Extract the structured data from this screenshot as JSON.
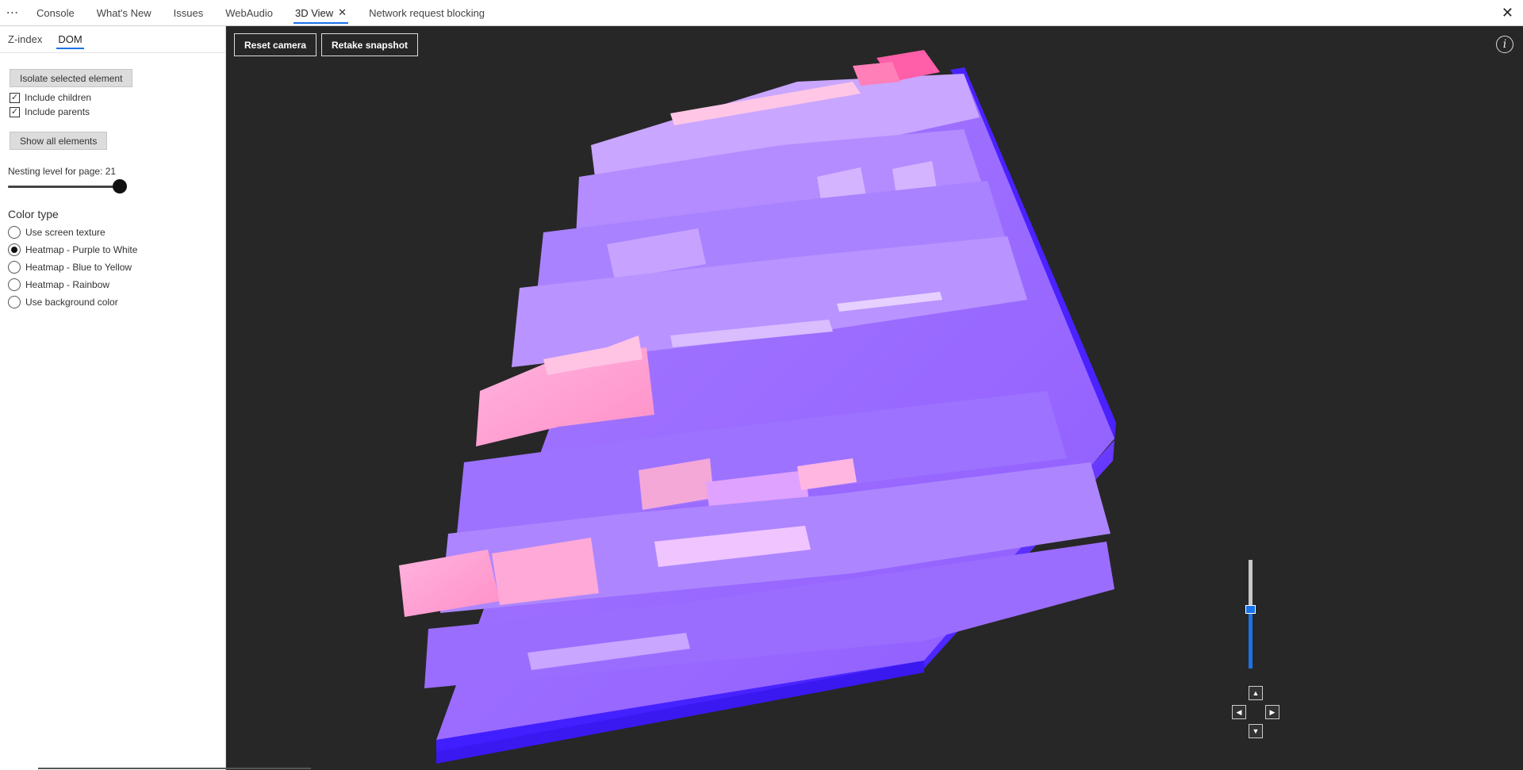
{
  "toolbar": {
    "more_icon": "more-horizontal-icon",
    "tabs": [
      {
        "label": "Console"
      },
      {
        "label": "What's New"
      },
      {
        "label": "Issues"
      },
      {
        "label": "WebAudio"
      },
      {
        "label": "3D View",
        "active": true
      },
      {
        "label": "Network request blocking"
      }
    ],
    "close_glyph": "✕"
  },
  "sidebar": {
    "subtabs": [
      {
        "label": "Z-index"
      },
      {
        "label": "DOM",
        "active": true
      }
    ],
    "isolate_label": "Isolate selected element",
    "include_children_label": "Include children",
    "include_children_checked": true,
    "include_parents_label": "Include parents",
    "include_parents_checked": true,
    "show_all_label": "Show all elements",
    "nesting_label": "Nesting level for page: 21",
    "nesting_value": 21,
    "color_type_title": "Color type",
    "color_options": [
      {
        "label": "Use screen texture",
        "selected": false
      },
      {
        "label": "Heatmap - Purple to White",
        "selected": true
      },
      {
        "label": "Heatmap - Blue to Yellow",
        "selected": false
      },
      {
        "label": "Heatmap - Rainbow",
        "selected": false
      },
      {
        "label": "Use background color",
        "selected": false
      }
    ]
  },
  "viewport": {
    "reset_camera_label": "Reset camera",
    "retake_snapshot_label": "Retake snapshot",
    "info_glyph": "i",
    "zoom_fraction": 0.55,
    "colors": {
      "background": "#272727",
      "purple": "#6b3bff",
      "lavender": "#b38cff",
      "pink": "#ff9ecf",
      "accent": "#1a73e8"
    }
  }
}
